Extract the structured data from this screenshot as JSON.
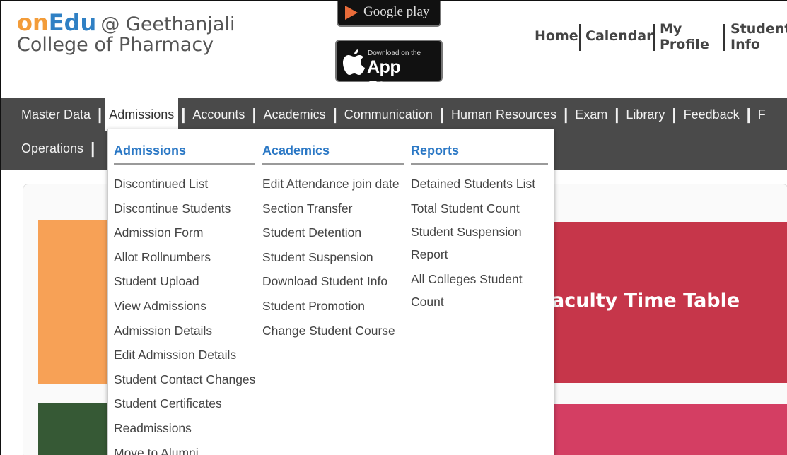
{
  "brand": {
    "on": "on",
    "edu": "Edu",
    "at": "@ Geethanjali",
    "college": "College of Pharmacy"
  },
  "stores": {
    "google_play": "Google play",
    "app_store_small": "Download on the",
    "app_store_big": "App Store"
  },
  "topnav": {
    "home": "Home",
    "calendar": "Calendar",
    "my_profile_1": "My",
    "my_profile_2": "Profile",
    "student_info_1": "Student",
    "student_info_2": "Info"
  },
  "navbar": {
    "row1": [
      "Master Data",
      "Admissions",
      "Accounts",
      "Academics",
      "Communication",
      "Human Resources",
      "Exam",
      "Library",
      "Feedback",
      "F"
    ],
    "row2": [
      "Operations"
    ]
  },
  "dropdown": {
    "admissions": {
      "title": "Admissions",
      "items": [
        "Discontinued List",
        "Discontinue Students",
        "Admission Form",
        "Allot Rollnumbers",
        "Student Upload",
        "View Admissions",
        "Admission Details",
        "Edit Admission Details",
        "Student Contact Changes",
        "Student Certificates",
        "Readmissions",
        "Move to Alumni"
      ]
    },
    "academics": {
      "title": "Academics",
      "items": [
        "Edit Attendance join date",
        "Section Transfer",
        "Student Detention",
        "Student Suspension",
        "Download Student Info",
        "Student Promotion",
        "Change Student Course"
      ]
    },
    "reports": {
      "title": "Reports",
      "items": [
        "Detained Students List",
        "Total Student Count",
        "Student Suspension Report",
        "All Colleges Student Count"
      ]
    }
  },
  "content": {
    "tile_title": "aculty Time Table"
  },
  "colors": {
    "nav_bg": "#4a4a4a",
    "accent_blue": "#2b78c5",
    "brand_orange": "#f39c39",
    "tile_orange": "#f7a156",
    "tile_red": "#c6364a",
    "tile_green": "#365935",
    "tile_pink": "#d43e63"
  }
}
